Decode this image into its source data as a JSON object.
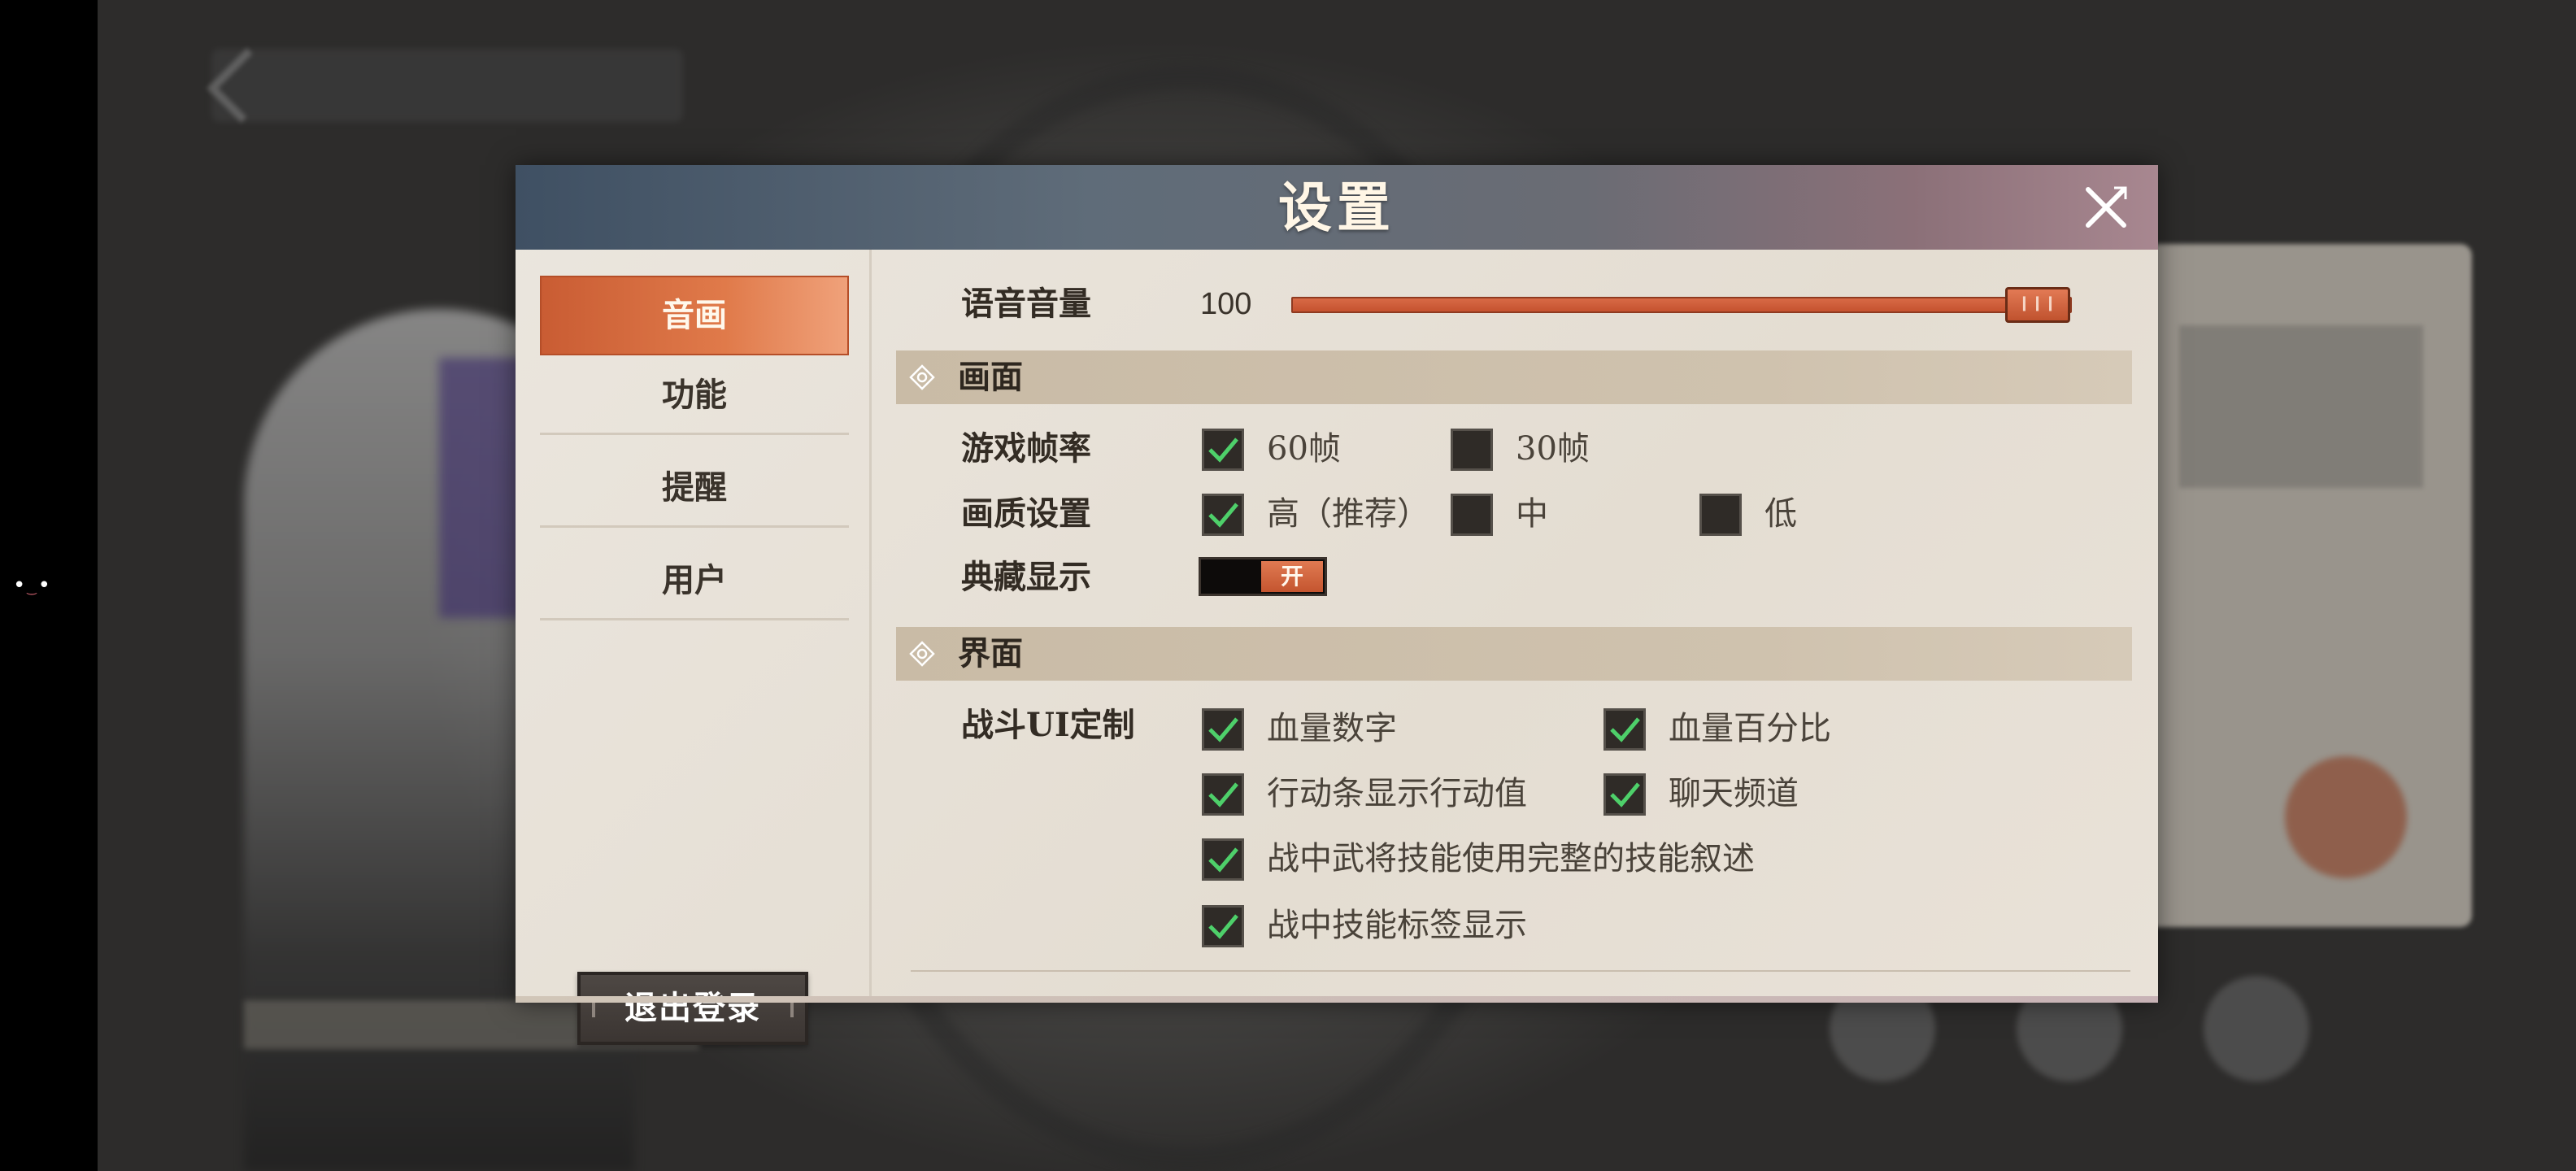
{
  "title": "设置",
  "sidebar": {
    "items": [
      {
        "label": "音画",
        "active": true
      },
      {
        "label": "功能",
        "active": false
      },
      {
        "label": "提醒",
        "active": false
      },
      {
        "label": "用户",
        "active": false
      }
    ],
    "logout_label": "退出登录"
  },
  "audio": {
    "voice_volume_label": "语音音量",
    "voice_volume_value": "100",
    "voice_volume_level": 100
  },
  "graphics": {
    "section_title": "画面",
    "framerate": {
      "label": "游戏帧率",
      "options": [
        {
          "label": "60帧",
          "checked": true
        },
        {
          "label": "30帧",
          "checked": false
        }
      ]
    },
    "quality": {
      "label": "画质设置",
      "options": [
        {
          "label": "高（推荐）",
          "checked": true
        },
        {
          "label": "中",
          "checked": false
        },
        {
          "label": "低",
          "checked": false
        }
      ]
    },
    "collection_display": {
      "label": "典藏显示",
      "state_label": "开",
      "on": true
    }
  },
  "interface": {
    "section_title": "界面",
    "battle_ui_label": "战斗UI定制",
    "options": [
      {
        "label": "血量数字",
        "checked": true
      },
      {
        "label": "血量百分比",
        "checked": true
      },
      {
        "label": "行动条显示行动值",
        "checked": true
      },
      {
        "label": "聊天频道",
        "checked": true
      },
      {
        "label": "战中武将技能使用完整的技能叙述",
        "checked": true
      },
      {
        "label": "战中技能标签显示",
        "checked": true
      }
    ]
  },
  "colors": {
    "accent": "#d0653f",
    "check": "#4ed06a",
    "checkbox_bg": "#2f2b27",
    "header_left": "#3f5063",
    "header_right": "#a88790"
  },
  "icons": {
    "close": "close-x-icon",
    "checkmark": "checkmark-icon",
    "section": "diamond-icon"
  }
}
